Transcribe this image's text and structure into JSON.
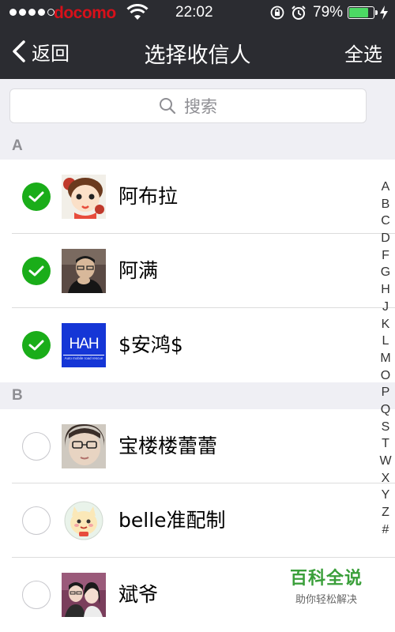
{
  "status_bar": {
    "carrier": "docomo",
    "time": "22:02",
    "battery_percent": "79%",
    "battery_level": 0.79,
    "signal_bars": 5,
    "signal_filled": 4,
    "icons": [
      "signal-dots-icon",
      "wifi-icon",
      "rotation-lock-icon",
      "alarm-icon",
      "battery-icon",
      "charging-bolt-icon"
    ]
  },
  "nav": {
    "back_label": "返回",
    "title": "选择收信人",
    "select_all_label": "全选"
  },
  "search": {
    "placeholder": "搜索",
    "icon": "search-icon"
  },
  "sections": [
    {
      "letter": "A",
      "contacts": [
        {
          "name": "阿布拉",
          "selected": true
        },
        {
          "name": "阿满",
          "selected": true
        },
        {
          "name": "$安鸿$",
          "selected": true,
          "avatar_text": "HAH",
          "avatar_caption": "Auto mobile road rescue"
        }
      ]
    },
    {
      "letter": "B",
      "contacts": [
        {
          "name": "宝楼楼蕾蕾",
          "selected": false
        },
        {
          "name": "belle准配制",
          "selected": false
        },
        {
          "name": "斌爷",
          "selected": false
        }
      ]
    }
  ],
  "index_letters": [
    "A",
    "B",
    "C",
    "D",
    "F",
    "G",
    "H",
    "J",
    "K",
    "L",
    "M",
    "O",
    "P",
    "Q",
    "S",
    "T",
    "W",
    "X",
    "Y",
    "Z",
    "#"
  ],
  "watermark": {
    "title": "百科全说",
    "subtitle": "助你轻松解决"
  },
  "colors": {
    "nav_background": "#2b2c31",
    "check_green": "#1aad19",
    "section_background": "#efeff4",
    "carrier_red": "#d8101a",
    "battery_green": "#4cd964"
  }
}
